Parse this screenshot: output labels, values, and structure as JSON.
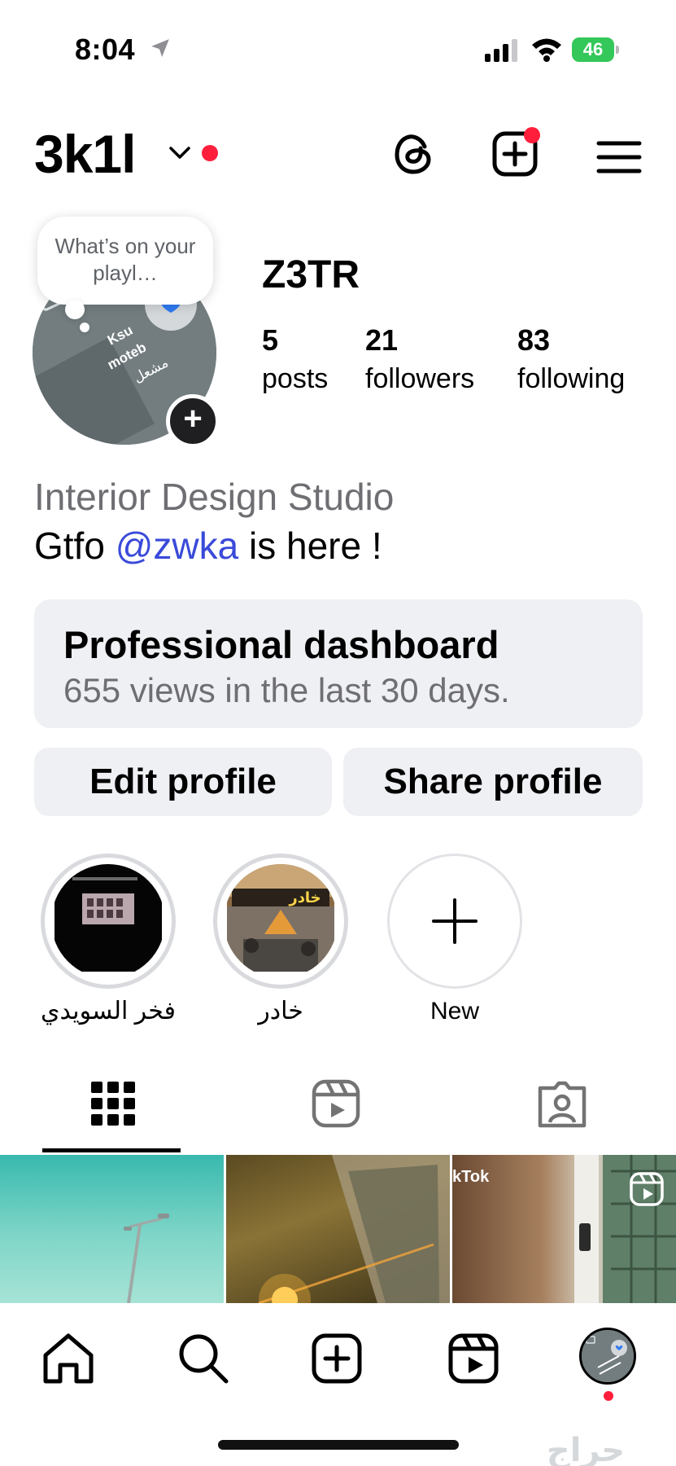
{
  "status_bar": {
    "time": "8:04",
    "battery": "46"
  },
  "header": {
    "username": "3k1l",
    "icons": [
      "chevron-down-icon",
      "threads-icon",
      "create-icon",
      "menu-icon"
    ]
  },
  "profile": {
    "note": "What’s on your playl…",
    "display_name": "Z3TR",
    "stats": {
      "posts_count": "5",
      "posts_label": "posts",
      "followers_count": "21",
      "followers_label": "followers",
      "following_count": "83",
      "following_label": "following"
    },
    "avatar_text": [
      "Ksu",
      "moteb",
      "مشعل"
    ],
    "category": "Interior Design Studio",
    "bio_prefix": "Gtfo ",
    "bio_mention": "@zwka",
    "bio_suffix": " is here !"
  },
  "dashboard": {
    "title": "Professional dashboard",
    "subtitle": "655 views in the last 30 days."
  },
  "buttons": {
    "edit": "Edit profile",
    "share": "Share profile"
  },
  "highlights": [
    {
      "label": "فخر السويدي"
    },
    {
      "label": "خادر",
      "image_text": "خادر"
    },
    {
      "label": "New"
    }
  ],
  "tabs": [
    "grid-icon",
    "reels-icon",
    "tagged-icon"
  ],
  "posts": [
    {
      "caption": ""
    },
    {
      "caption": ""
    },
    {
      "caption": "kTok"
    }
  ],
  "bottom_nav": [
    "home-icon",
    "search-icon",
    "create-icon",
    "reels-icon",
    "profile-avatar"
  ],
  "watermark": "حراج",
  "colors": {
    "accent_red": "#ff1f3d",
    "mention_blue": "#3a4ad9",
    "button_bg": "#eff0f3",
    "battery_green": "#34c759"
  }
}
